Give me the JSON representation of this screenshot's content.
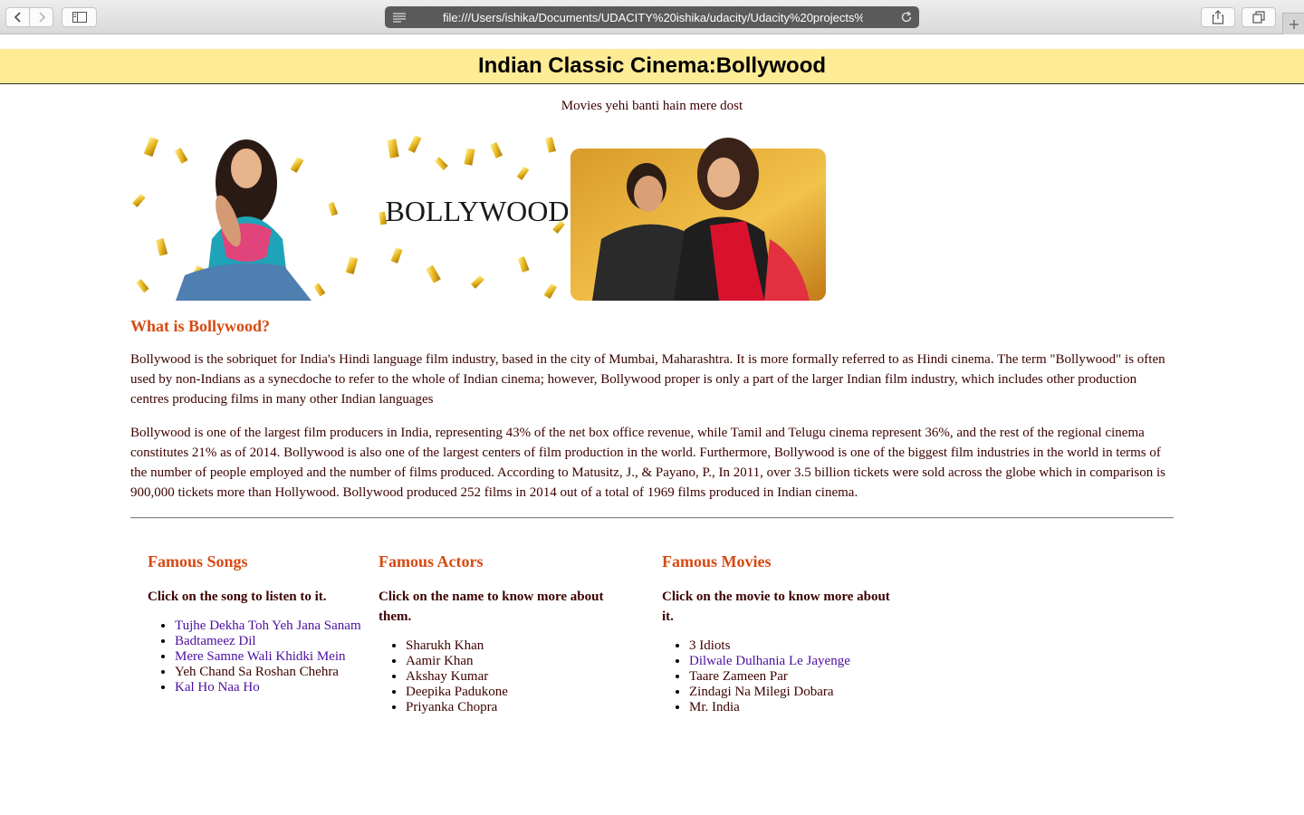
{
  "browser": {
    "url": "file:///Users/ishika/Documents/UDACITY%20ishika/udacity/Udacity%20projects%2"
  },
  "header": {
    "title": "Indian Classic Cinema:Bollywood",
    "tagline": "Movies yehi banti hain mere dost"
  },
  "banner": {
    "text": "BOLLYWOOD"
  },
  "about": {
    "heading": "What is Bollywood?",
    "paragraph1": "Bollywood is the sobriquet for India's Hindi language film industry, based in the city of Mumbai, Maharashtra. It is more formally referred to as Hindi cinema. The term \"Bollywood\" is often used by non-Indians as a synecdoche to refer to the whole of Indian cinema; however, Bollywood proper is only a part of the larger Indian film industry, which includes other production centres producing films in many other Indian languages",
    "paragraph2": "Bollywood is one of the largest film producers in India, representing 43% of the net box office revenue, while Tamil and Telugu cinema represent 36%, and the rest of the regional cinema constitutes 21% as of 2014. Bollywood is also one of the largest centers of film production in the world. Furthermore, Bollywood is one of the biggest film industries in the world in terms of the number of people employed and the number of films produced. According to Matusitz, J., & Payano, P., In 2011, over 3.5 billion tickets were sold across the globe which in comparison is 900,000 tickets more than Hollywood. Bollywood produced 252 films in 2014 out of a total of 1969 films produced in Indian cinema."
  },
  "songs": {
    "heading": "Famous Songs",
    "hint": "Click on the song to listen to it.",
    "items": [
      {
        "label": "Tujhe Dekha Toh Yeh Jana Sanam",
        "link": true
      },
      {
        "label": "Badtameez Dil",
        "link": true
      },
      {
        "label": "Mere Samne Wali Khidki Mein",
        "link": true
      },
      {
        "label": "Yeh Chand Sa Roshan Chehra",
        "link": false
      },
      {
        "label": "Kal Ho Naa Ho",
        "link": true
      }
    ]
  },
  "actors": {
    "heading": "Famous Actors",
    "hint": "Click on the name to know more about them.",
    "items": [
      {
        "label": "Sharukh Khan",
        "link": false
      },
      {
        "label": "Aamir Khan",
        "link": false
      },
      {
        "label": "Akshay Kumar",
        "link": false
      },
      {
        "label": "Deepika Padukone",
        "link": false
      },
      {
        "label": "Priyanka Chopra",
        "link": false
      }
    ]
  },
  "movies": {
    "heading": "Famous Movies",
    "hint": "Click on the movie to know more about it.",
    "items": [
      {
        "label": "3 Idiots",
        "link": false
      },
      {
        "label": "Dilwale Dulhania Le Jayenge",
        "link": true
      },
      {
        "label": "Taare Zameen Par",
        "link": false
      },
      {
        "label": "Zindagi Na Milegi Dobara",
        "link": false
      },
      {
        "label": "Mr. India",
        "link": false
      }
    ]
  },
  "colors": {
    "header_band": "#fdeb95",
    "heading_accent": "#d64a12",
    "body_text": "#3d0000",
    "link": "#4b0ea0"
  }
}
